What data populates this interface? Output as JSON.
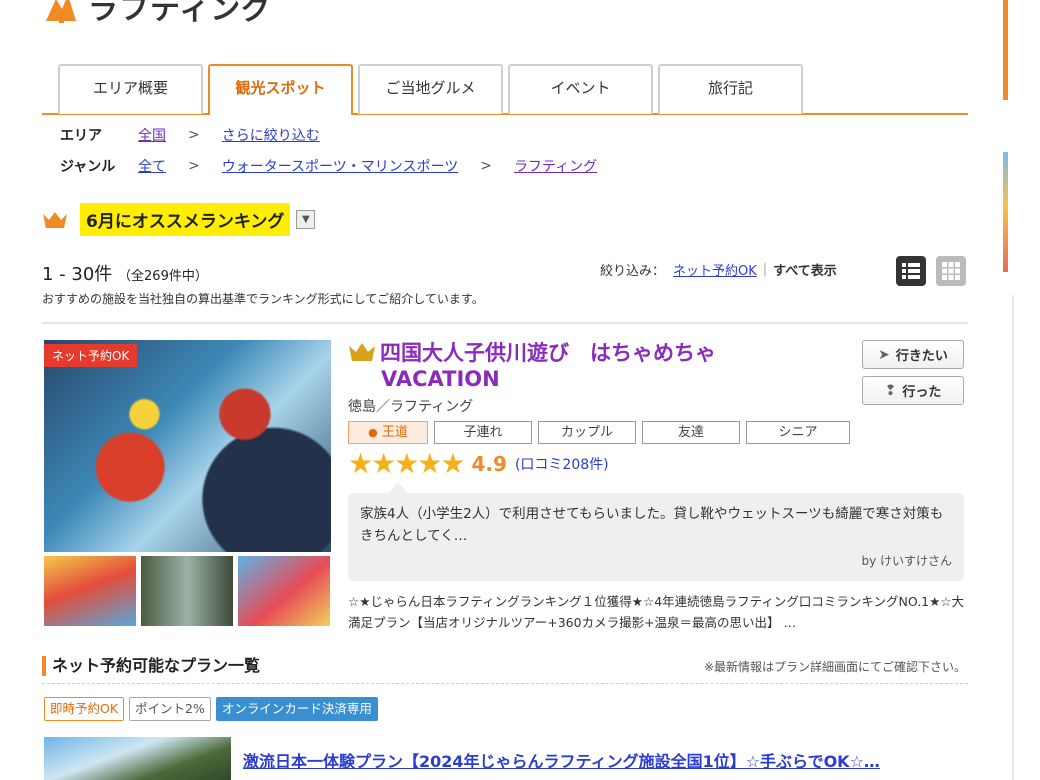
{
  "page": {
    "heading": "ラフティング"
  },
  "tabs": [
    {
      "label": "エリア概要"
    },
    {
      "label": "観光スポット",
      "active": true
    },
    {
      "label": "ご当地グルメ"
    },
    {
      "label": "イベント"
    },
    {
      "label": "旅行記"
    }
  ],
  "breadcrumbs": {
    "area": {
      "label": "エリア",
      "items": [
        "全国",
        "さらに絞り込む"
      ]
    },
    "genre": {
      "label": "ジャンル",
      "items": [
        "全て",
        "ウォータースポーツ・マリンスポーツ",
        "ラフティング"
      ]
    },
    "separator": ">"
  },
  "ranking": {
    "title": "6月にオススメランキング",
    "dropdown_icon": "triangle-down",
    "count_range": "1 - 30件",
    "count_total": "（全269件中）",
    "description": "おすすめの施設を当社独自の算出基準でランキング形式にしてご紹介しています。"
  },
  "filter": {
    "label": "絞り込み：",
    "options": [
      "ネット予約OK",
      "すべて表示"
    ],
    "separator": "|"
  },
  "listing": {
    "badge": "ネット予約OK",
    "title_line1": "四国大人子供川遊び　はちゃめちゃ",
    "title_line2": "VACATION",
    "area": "徳島／ラフティング",
    "tags": [
      "王道",
      "子連れ",
      "カップル",
      "友達",
      "シニア"
    ],
    "stars": "★★★★★",
    "rating": 4.9,
    "rating_text": "4.9",
    "reviews_link": "(口コミ208件)",
    "review_text": "家族4人（小学生2人）で利用させてもらいました。貸し靴やウェットスーツも綺麗で寒さ対策もきちんとしてく…",
    "review_by": "by けいすけさん",
    "catch_copy": "☆★じゃらん日本ラフティングランキング１位獲得★☆4年連続徳島ラフティング口コミランキングNO.1★☆大満足プラン【当店オリジナルツアー+360カメラ撮影+温泉＝最高の思い出】 …",
    "want_to_go": "行きたい",
    "went": "行った"
  },
  "plans": {
    "heading": "ネット予約可能なプラン一覧",
    "note": "※最新情報はプラン詳細画面にてご確認下さい。",
    "labels": [
      "即時予約OK",
      "ポイント2%",
      "オンラインカード決済専用"
    ],
    "first_plan": "激流日本一体験プラン【2024年じゃらんラフティング施設全国1位】☆手ぶらでOK☆…"
  },
  "colors": {
    "accent": "#f08a24",
    "title_purple": "#8a2bbd",
    "link_blue": "#2a3cd2",
    "highlight": "#ffee00"
  }
}
